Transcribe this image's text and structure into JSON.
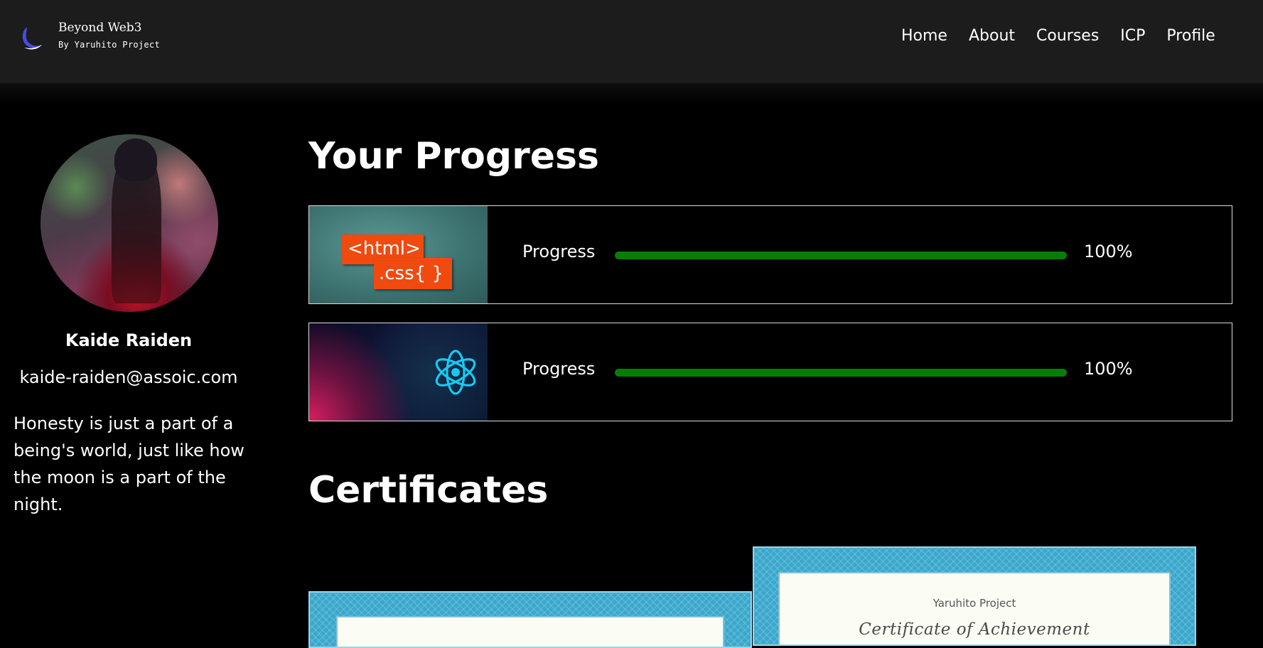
{
  "header": {
    "brand_title": "Beyond Web3",
    "brand_subtitle": "By Yaruhito Project",
    "nav": [
      "Home",
      "About",
      "Courses",
      "ICP",
      "Profile"
    ]
  },
  "profile": {
    "name": "Kaide Raiden",
    "email": "kaide-raiden@assoic.com",
    "bio": "Honesty is just a part of a being's world, just like how the moon is a part of the night."
  },
  "progress": {
    "title": "Your Progress",
    "items": [
      {
        "thumb_tag1": "<html>",
        "thumb_tag2": ".css{ }",
        "label": "Progress",
        "percent": "100%",
        "value": 1.0
      },
      {
        "thumb_icon": "react-atom-icon",
        "label": "Progress",
        "percent": "100%",
        "value": 1.0
      }
    ]
  },
  "certificates": {
    "title": "Certificates",
    "items": [
      {
        "org": "",
        "title": ""
      },
      {
        "org": "Yaruhito Project",
        "title": "Certificate of Achievement"
      }
    ]
  },
  "colors": {
    "header_bg": "#1c1c1c",
    "page_bg": "#000000",
    "progress_fill": "#067e06",
    "html_tag_bg": "#f04a10",
    "react_accent": "#19c8f0",
    "cert_border": "#3aa7cc"
  }
}
